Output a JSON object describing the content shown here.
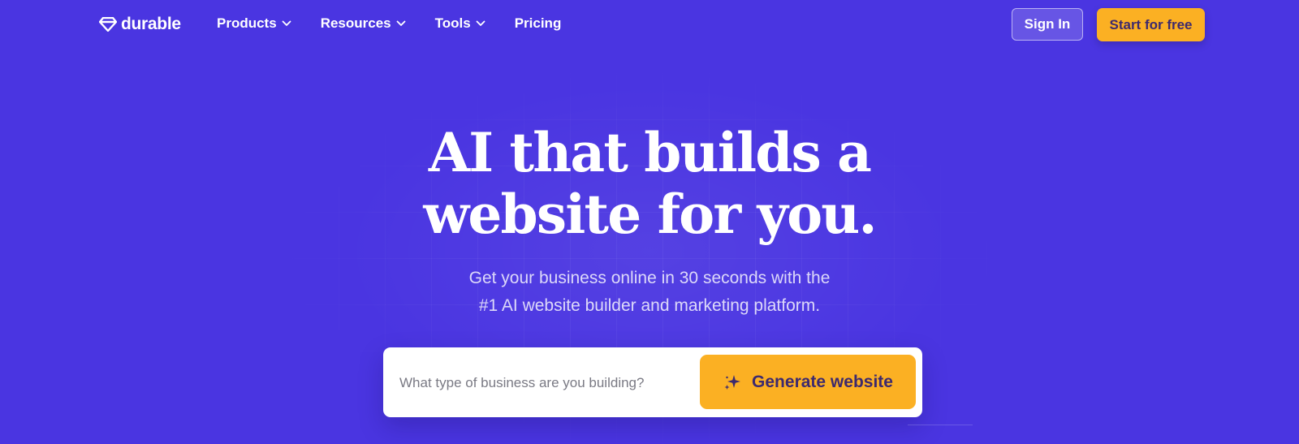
{
  "brand": {
    "name": "durable",
    "icon": "diamond-logo-icon"
  },
  "nav": {
    "items": [
      {
        "label": "Products",
        "dropdown": true
      },
      {
        "label": "Resources",
        "dropdown": true
      },
      {
        "label": "Tools",
        "dropdown": true
      },
      {
        "label": "Pricing",
        "dropdown": false
      }
    ]
  },
  "header": {
    "sign_in_label": "Sign In",
    "start_label": "Start for free"
  },
  "hero": {
    "headline_line1": "AI that builds a",
    "headline_line2": "website for you.",
    "subline_line1": "Get your business online in 30 seconds with the",
    "subline_line2": "#1 AI website builder and marketing platform."
  },
  "prompt": {
    "placeholder": "What type of business are you building?",
    "value": "",
    "generate_label": "Generate website",
    "generate_icon": "sparkle-icon"
  },
  "colors": {
    "background": "#4a35e1",
    "accent": "#fbb023",
    "accent_text": "#3d2a6e"
  }
}
